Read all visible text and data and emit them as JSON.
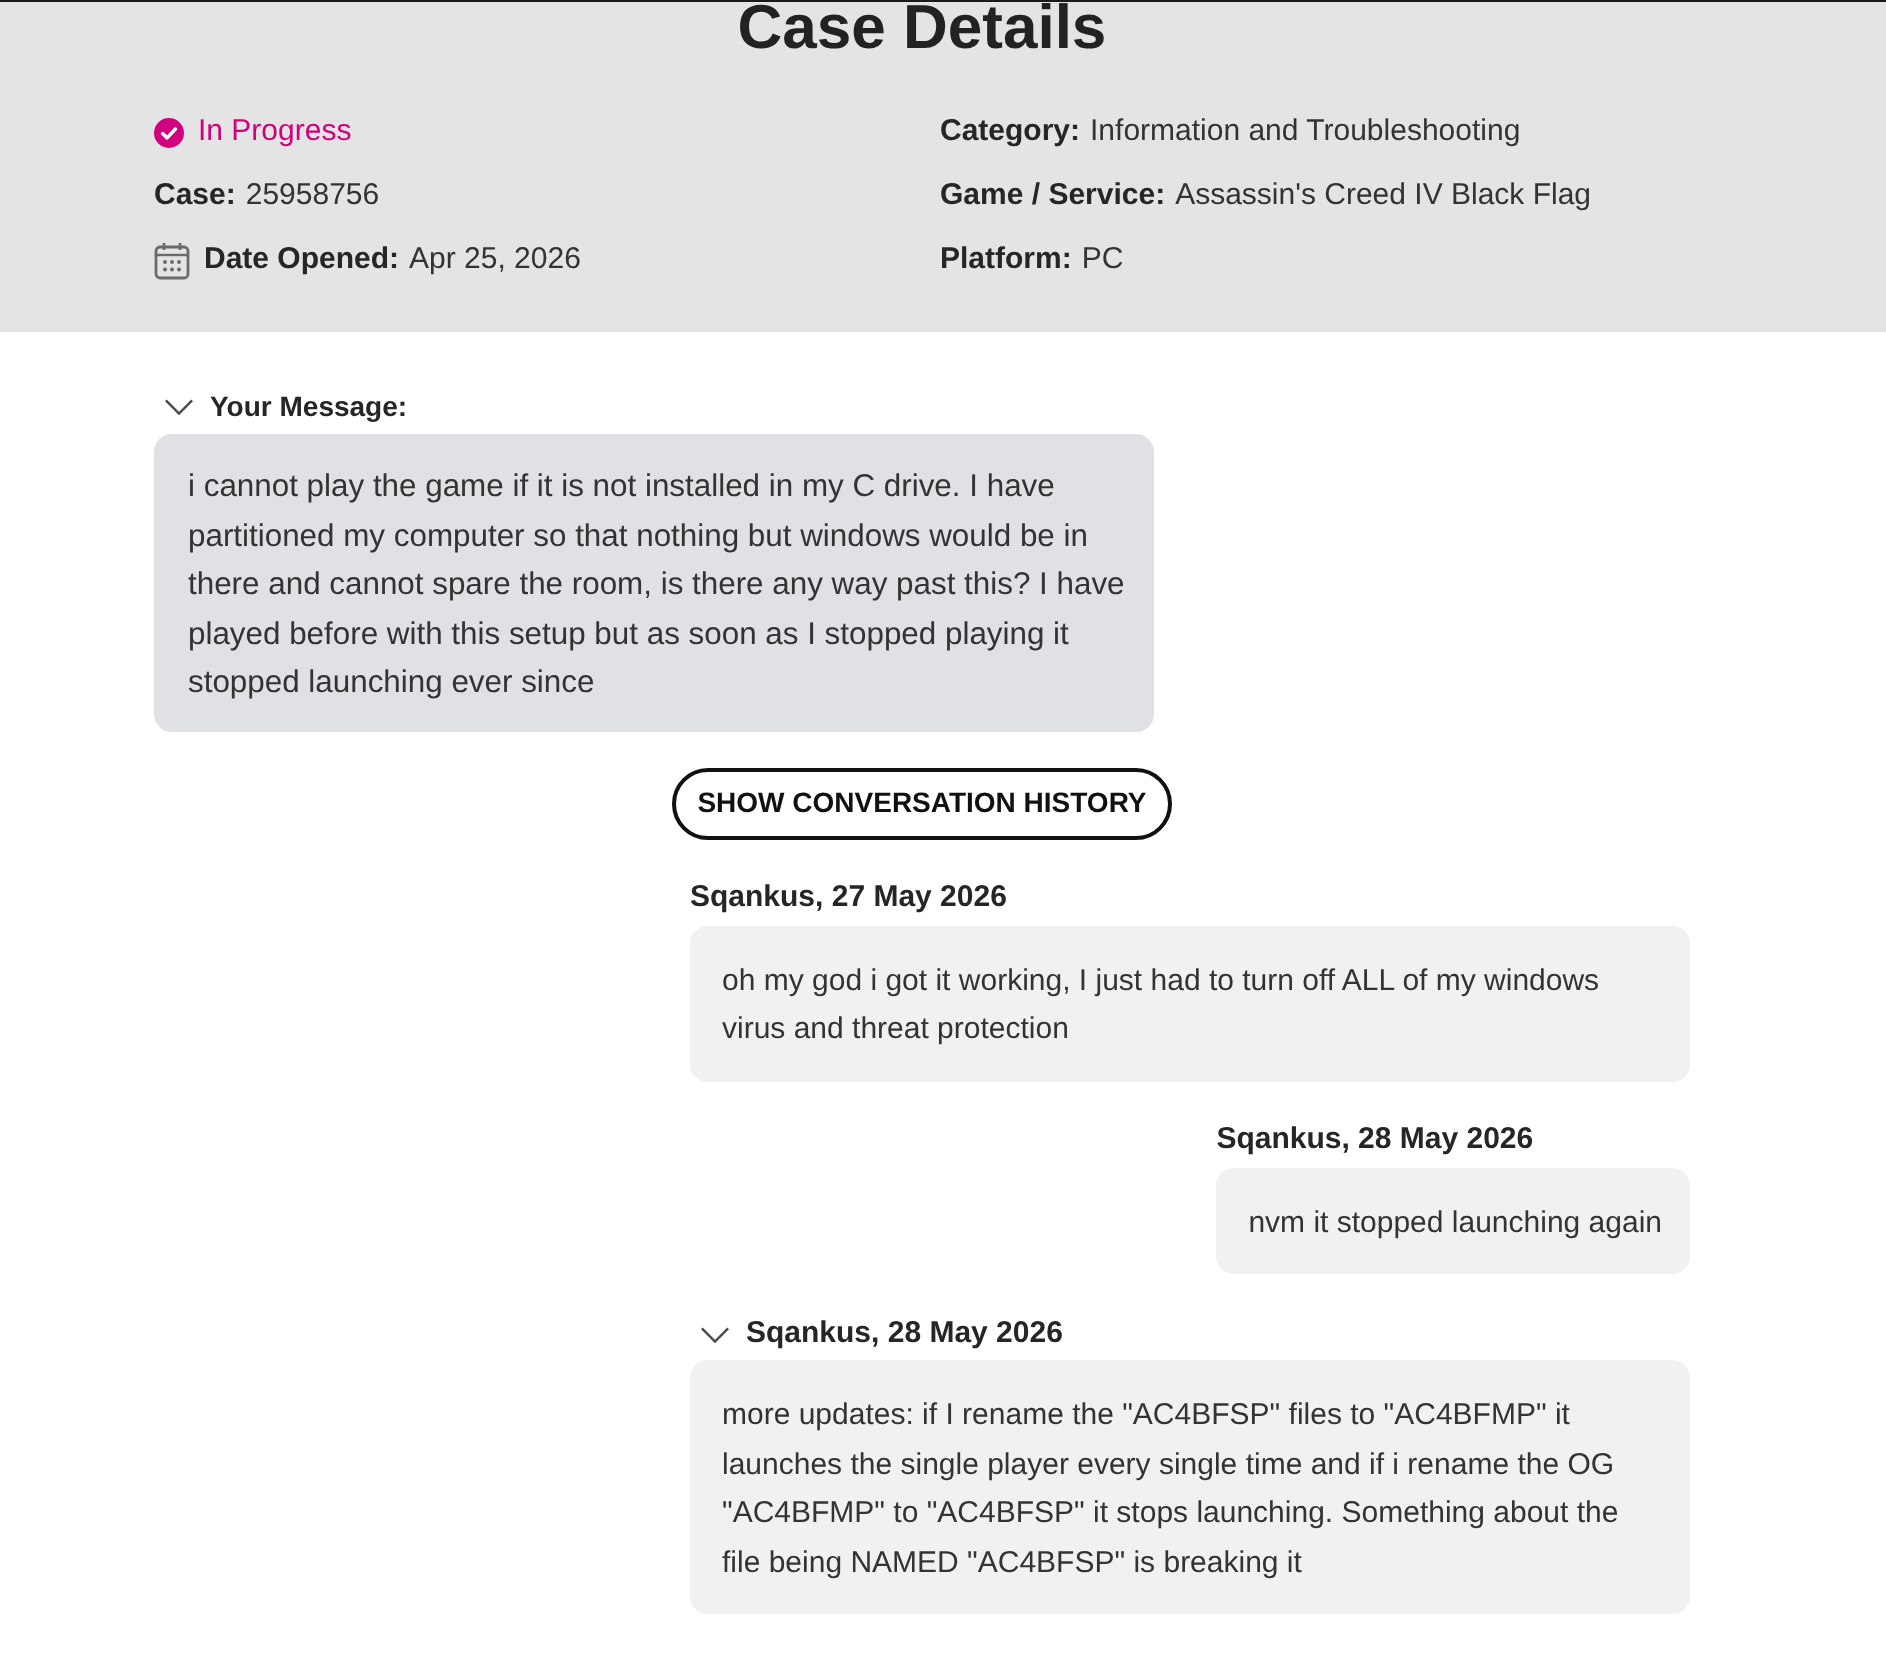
{
  "title": "Case Details",
  "details": {
    "left": [
      {
        "kind": "status",
        "text": "In Progress"
      },
      {
        "kind": "field",
        "label": "Case:",
        "value": "25958756"
      },
      {
        "kind": "date",
        "label": "Date Opened:",
        "value": "Apr 25, 2026"
      }
    ],
    "right": [
      {
        "kind": "field",
        "label": "Category:",
        "value": "Information and Troubleshooting"
      },
      {
        "kind": "field",
        "label": "Game / Service:",
        "value": "Assassin's Creed IV Black Flag"
      },
      {
        "kind": "field",
        "label": "Platform:",
        "value": "PC"
      }
    ]
  },
  "your_message": {
    "label": "Your Message:",
    "expanded": true,
    "text": "i cannot play the game if it is not installed in my C drive. I have partitioned my computer so that nothing but windows would be in there and cannot spare the room, is there any way past this? I have played before with this setup but as soon as I stopped playing it stopped launching ever since"
  },
  "history_button": "SHOW CONVERSATION HISTORY",
  "replies": [
    {
      "kind": "plain",
      "author_date": "Sqankus, 27 May 2026",
      "text": "oh my god i got it working, I just had to turn off ALL of my windows virus and threat protection"
    },
    {
      "kind": "plain",
      "author_date": "Sqankus, 28 May 2026",
      "text": "nvm it stopped launching again"
    },
    {
      "kind": "collapsible",
      "expanded": true,
      "author_date": "Sqankus, 28 May 2026",
      "text": "more updates: if I rename the \"AC4BFSP\" files to \"AC4BFMP\" it launches the single player every single time and if i rename the OG \"AC4BFMP\" to \"AC4BFSP\" it stops launching. Something about the file being NAMED \"AC4BFSP\" is breaking it"
    }
  ]
}
